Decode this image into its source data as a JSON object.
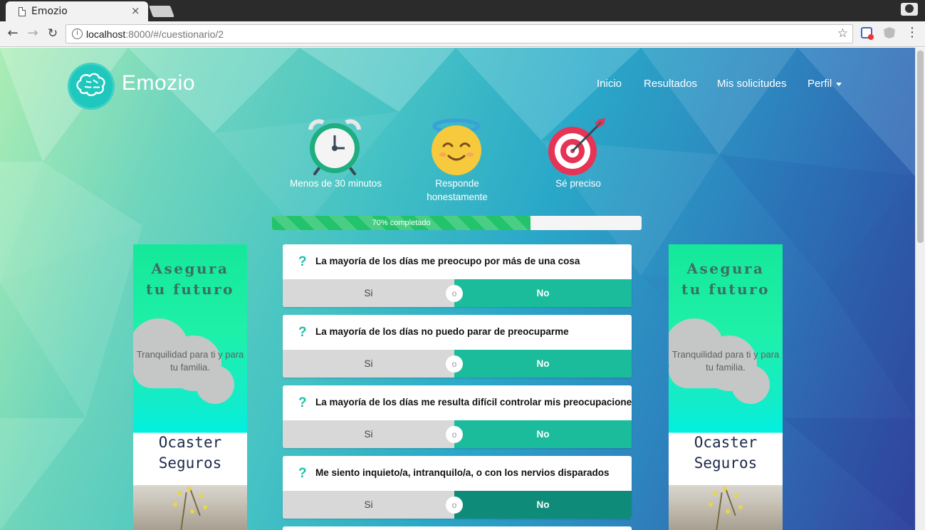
{
  "browser": {
    "tab_title": "Emozio",
    "tab_close": "×",
    "url_host": "localhost",
    "url_path": ":8000/#/cuestionario/2",
    "icons": [
      "page-icon",
      "close-icon",
      "back-arrow-icon",
      "forward-arrow-icon",
      "reload-icon",
      "info-icon",
      "star-icon",
      "extension-icon",
      "angular-extension-icon",
      "menu-icon",
      "profile-icon"
    ]
  },
  "navbar": {
    "brand": "Emozio",
    "links": [
      "Inicio",
      "Resultados",
      "Mis solicitudes",
      "Perfil"
    ]
  },
  "tips": [
    {
      "icon": "alarm-clock-icon",
      "label": "Menos de 30 minutos"
    },
    {
      "icon": "angel-face-icon",
      "label": "Responde honestamente"
    },
    {
      "icon": "target-icon",
      "label": "Sé preciso"
    }
  ],
  "progress": {
    "value": 0.7,
    "label": "70% completado"
  },
  "ad": {
    "title_line1": "Asegura",
    "title_line2": "tu futuro",
    "tagline": "Tranquilidad para ti y para tu familia.",
    "brand_line1": "Ocaster",
    "brand_line2": "Seguros"
  },
  "questions": [
    {
      "text": "La mayoría de los días me preocupo por más de una cosa",
      "yes": "Si",
      "or": "o",
      "no": "No",
      "selected": "no"
    },
    {
      "text": "La mayoría de los días no puedo parar de preocuparme",
      "yes": "Si",
      "or": "o",
      "no": "No",
      "selected": "no"
    },
    {
      "text": "La mayoría de los días me resulta difícil controlar mis preocupaciones",
      "yes": "Si",
      "or": "o",
      "no": "No",
      "selected": "no"
    },
    {
      "text": "Me siento inquieto/a, intranquilo/a, o con los nervios disparados",
      "yes": "Si",
      "or": "o",
      "no": "No",
      "selected": "no"
    }
  ],
  "colors": {
    "accent": "#1abc9c",
    "accent_active": "#0f8c79",
    "progress": "#22c36b",
    "question_mark": "#1bbfa7"
  }
}
